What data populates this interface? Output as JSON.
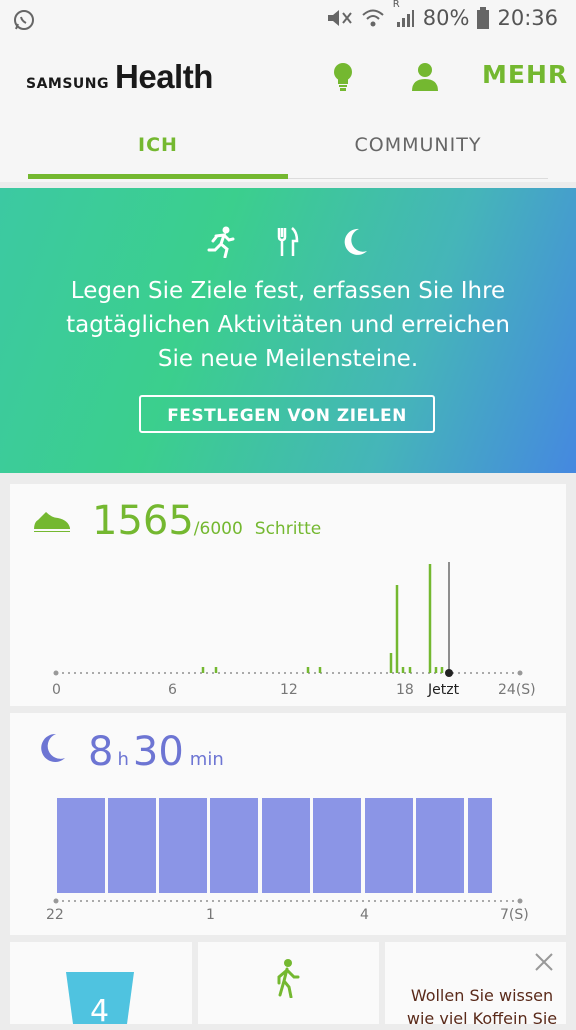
{
  "statusbar": {
    "battery": "80%",
    "time": "20:36",
    "network_label": "R"
  },
  "header": {
    "brand_samsung": "SAMSUNG",
    "brand_health": "Health",
    "more_label": "MEHR"
  },
  "tabs": [
    {
      "label": "ICH",
      "active": true
    },
    {
      "label": "COMMUNITY",
      "active": false
    }
  ],
  "hero": {
    "line1": "Legen Sie Ziele fest, erfassen Sie Ihre",
    "line2": "tagtäglichen Aktivitäten und erreichen",
    "line3": "Sie neue Meilensteine.",
    "button_label": "FESTLEGEN VON ZIELEN"
  },
  "steps": {
    "count": "1565",
    "goal": "/6000",
    "unit": "Schritte",
    "axis_labels": [
      "0",
      "6",
      "12",
      "18",
      "Jetzt",
      "24(S)"
    ]
  },
  "sleep": {
    "hours": "8",
    "hours_unit": "h",
    "minutes": "30",
    "minutes_unit": "min",
    "axis_labels": [
      "22",
      "1",
      "4",
      "7(S)"
    ]
  },
  "coffee_card": {
    "line1": "Wollen Sie wissen",
    "line2": "wie viel Koffein Sie"
  },
  "water_card": {
    "value": "4"
  },
  "colors": {
    "accent": "#74b830",
    "sleep": "#8b95e6",
    "hero_start": "#3cc9a2",
    "hero_end": "#4588e0"
  }
}
